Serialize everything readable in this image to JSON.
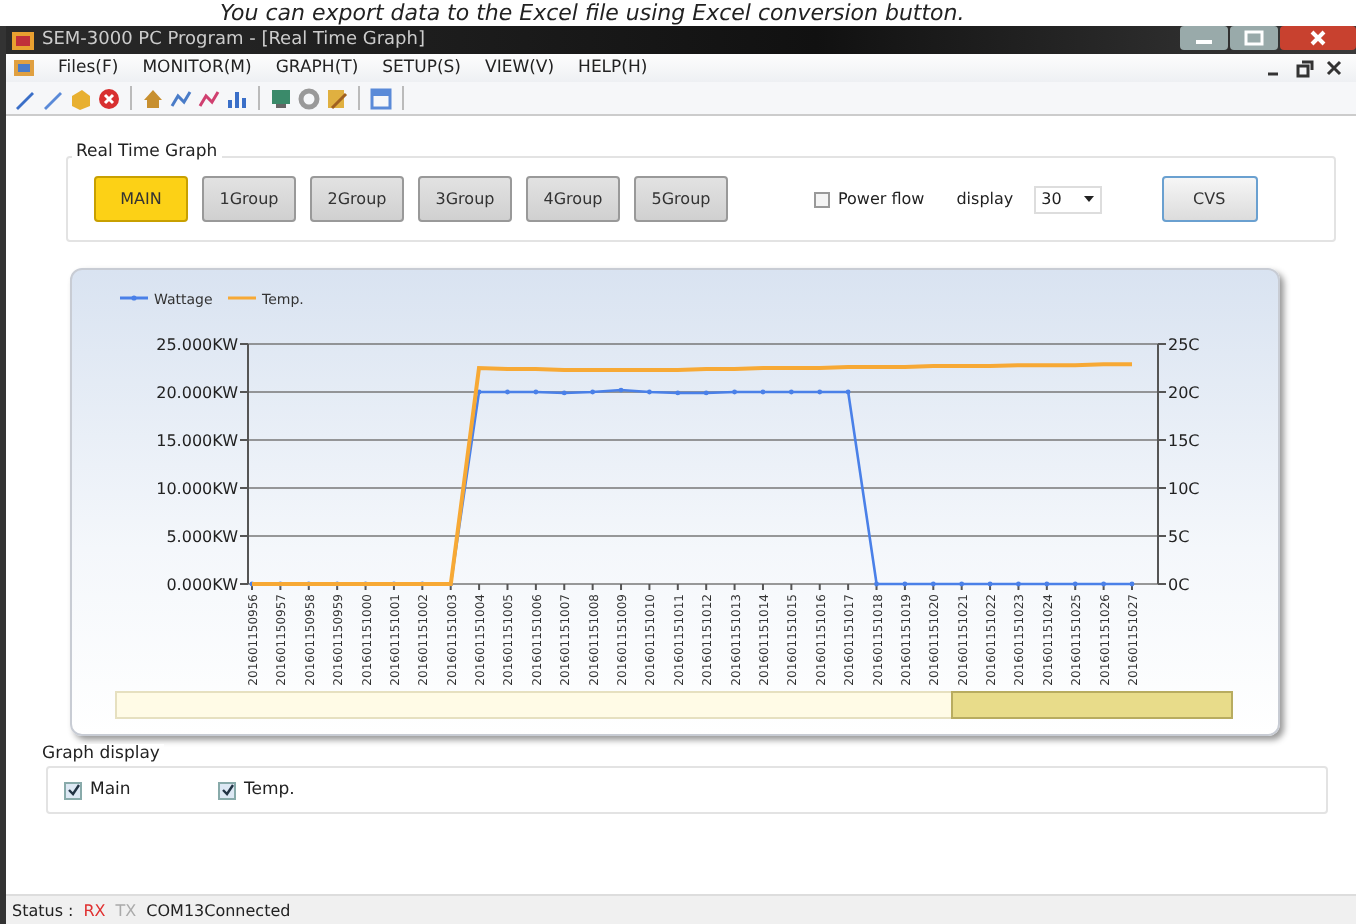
{
  "caption": "You can export data to the Excel file using Excel conversion button.",
  "window": {
    "title": "SEM-3000 PC Program - [Real Time Graph]"
  },
  "menu": [
    {
      "label": "Files(F)"
    },
    {
      "label": "MONITOR(M)"
    },
    {
      "label": "GRAPH(T)"
    },
    {
      "label": "SETUP(S)"
    },
    {
      "label": "VIEW(V)"
    },
    {
      "label": "HELP(H)"
    }
  ],
  "real_time_graph": {
    "label": "Real Time Graph",
    "groups": [
      {
        "label": "MAIN",
        "selected": true
      },
      {
        "label": "1Group",
        "selected": false
      },
      {
        "label": "2Group",
        "selected": false
      },
      {
        "label": "3Group",
        "selected": false
      },
      {
        "label": "4Group",
        "selected": false
      },
      {
        "label": "5Group",
        "selected": false
      }
    ],
    "power_flow": {
      "label": "Power flow",
      "checked": false
    },
    "display": {
      "label": "display",
      "value": "30"
    },
    "export_button": "CVS"
  },
  "chart": {
    "right_axis_labels": [
      "25C",
      "20C",
      "15C",
      "10C",
      "5C",
      "0C"
    ],
    "chart_data": {
      "type": "line",
      "categories": [
        "201601150956",
        "201601150957",
        "201601150958",
        "201601150959",
        "201601151000",
        "201601151001",
        "201601151002",
        "201601151003",
        "201601151004",
        "201601151005",
        "201601151006",
        "201601151007",
        "201601151008",
        "201601151009",
        "201601151010",
        "201601151011",
        "201601151012",
        "201601151013",
        "201601151014",
        "201601151015",
        "201601151016",
        "201601151017",
        "201601151018",
        "201601151019",
        "201601151020",
        "201601151021",
        "201601151022",
        "201601151023",
        "201601151024",
        "201601151025",
        "201601151026",
        "201601151027"
      ],
      "series": [
        {
          "name": "Wattage",
          "color": "#4a80e8",
          "values": [
            0,
            0,
            0,
            0,
            0,
            0,
            0,
            0,
            20,
            20,
            20,
            19.9,
            20,
            20.2,
            20,
            19.9,
            19.9,
            20,
            20,
            20,
            20,
            20,
            0,
            0,
            0,
            0,
            0,
            0,
            0,
            0,
            0,
            0
          ]
        },
        {
          "name": "Temp.",
          "color": "#f7a935",
          "values": [
            0,
            0,
            0,
            0,
            0,
            0,
            0,
            0,
            22.5,
            22.4,
            22.4,
            22.3,
            22.3,
            22.3,
            22.3,
            22.3,
            22.4,
            22.4,
            22.5,
            22.5,
            22.5,
            22.6,
            22.6,
            22.6,
            22.7,
            22.7,
            22.7,
            22.8,
            22.8,
            22.8,
            22.9,
            22.9
          ]
        }
      ],
      "ylim": [
        0,
        25
      ],
      "grid": true,
      "legend": true,
      "yticks": [
        {
          "value": 0,
          "label": "0.000KW"
        },
        {
          "value": 5,
          "label": "5.000KW"
        },
        {
          "value": 10,
          "label": "10.000KW"
        },
        {
          "value": 15,
          "label": "15.000KW"
        },
        {
          "value": 20,
          "label": "20.000KW"
        },
        {
          "value": 25,
          "label": "25.000KW"
        }
      ]
    }
  },
  "graph_display": {
    "label": "Graph display",
    "items": [
      {
        "label": "Main",
        "checked": true
      },
      {
        "label": "Temp.",
        "checked": true
      }
    ]
  },
  "status": {
    "label": "Status :",
    "signals": [
      {
        "label": "RX",
        "on": true
      },
      {
        "label": "TX",
        "on": false
      }
    ],
    "port": "COM13Connected"
  }
}
